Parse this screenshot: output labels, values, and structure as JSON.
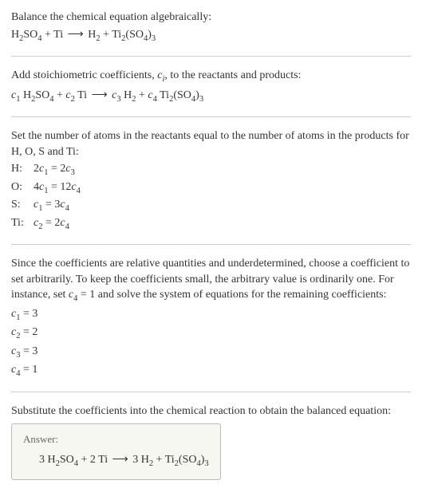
{
  "intro": {
    "line1": "Balance the chemical equation algebraically:",
    "eq_lhs1": "H",
    "eq_lhs2": "SO",
    "eq_lhs3": " + Ti ",
    "arrow": "⟶",
    "eq_rhs1": " H",
    "eq_rhs2": " + Ti",
    "eq_rhs3": "(SO",
    "eq_rhs4": ")"
  },
  "step_coeffs": {
    "line1a": "Add stoichiometric coefficients, ",
    "line1b": ", to the reactants and products:",
    "c": "c",
    "i": "i",
    "eq_c1": "c",
    "eq_h2so4_h": " H",
    "eq_h2so4_so": "SO",
    "eq_plus": " + ",
    "eq_ti": " Ti ",
    "arrow": "⟶",
    "eq_h2": " H",
    "eq_ti2": " Ti",
    "eq_so4": "(SO",
    "eq_close": ")"
  },
  "atom_balance": {
    "intro": "Set the number of atoms in the reactants equal to the number of atoms in the products for H, O, S and Ti:",
    "rows": [
      {
        "label": "H:",
        "lhs_coef": "2",
        "lhs_var": "c",
        "lhs_sub": "1",
        "eq": " = ",
        "rhs_coef": "2",
        "rhs_var": "c",
        "rhs_sub": "3"
      },
      {
        "label": "O:",
        "lhs_coef": "4",
        "lhs_var": "c",
        "lhs_sub": "1",
        "eq": " = ",
        "rhs_coef": "12",
        "rhs_var": "c",
        "rhs_sub": "4"
      },
      {
        "label": "S:",
        "lhs_coef": "",
        "lhs_var": "c",
        "lhs_sub": "1",
        "eq": " = ",
        "rhs_coef": "3",
        "rhs_var": "c",
        "rhs_sub": "4"
      },
      {
        "label": "Ti:",
        "lhs_coef": "",
        "lhs_var": "c",
        "lhs_sub": "2",
        "eq": " = ",
        "rhs_coef": "2",
        "rhs_var": "c",
        "rhs_sub": "4"
      }
    ]
  },
  "explain": {
    "text_a": "Since the coefficients are relative quantities and underdetermined, choose a coefficient to set arbitrarily. To keep the coefficients small, the arbitrary value is ordinarily one. For instance, set ",
    "c": "c",
    "sub4": "4",
    "eq1": " = 1 and solve the system of equations for the remaining coefficients:",
    "coefs": [
      {
        "var": "c",
        "sub": "1",
        "val": " = 3"
      },
      {
        "var": "c",
        "sub": "2",
        "val": " = 2"
      },
      {
        "var": "c",
        "sub": "3",
        "val": " = 3"
      },
      {
        "var": "c",
        "sub": "4",
        "val": " = 1"
      }
    ]
  },
  "final": {
    "intro": "Substitute the coefficients into the chemical reaction to obtain the balanced equation:",
    "answer_label": "Answer:",
    "eq": {
      "n1": "3 H",
      "so": "SO",
      "plus1": " + 2 Ti ",
      "arrow": "⟶",
      "n2": " 3 H",
      "plus2": " + Ti",
      "so4": "(SO",
      "close": ")"
    }
  },
  "subs": {
    "2": "2",
    "3": "3",
    "4": "4"
  }
}
